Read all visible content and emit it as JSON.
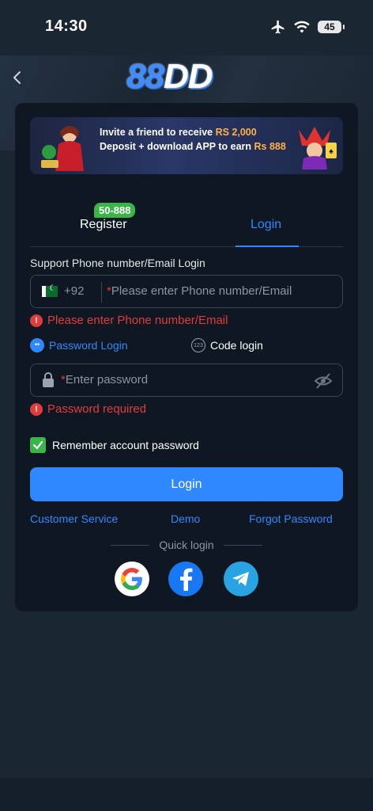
{
  "status": {
    "time": "14:30",
    "battery": "45"
  },
  "header": {
    "logo_a": "88",
    "logo_b": "DD"
  },
  "banner": {
    "line1_text": "Invite a friend to receive",
    "line1_amount": "RS 2,000",
    "line2_text": "Deposit + download APP to earn",
    "line2_amount": "Rs 888"
  },
  "tabs": {
    "register": "Register",
    "login": "Login",
    "register_badge": "50-888"
  },
  "form": {
    "support_label": "Support Phone number/Email Login",
    "country_code": "+92",
    "phone_placeholder": "Please enter Phone number/Email",
    "phone_error": "Please enter Phone number/Email",
    "mode_password": "Password Login",
    "mode_code": "Code login",
    "password_placeholder": "Enter password",
    "password_error": "Password required",
    "remember_label": "Remember account password",
    "login_button": "Login"
  },
  "links": {
    "customer_service": "Customer Service",
    "demo": "Demo",
    "forgot": "Forgot Password"
  },
  "quick_login": {
    "label": "Quick login"
  },
  "colors": {
    "accent": "#2f88ff",
    "error": "#e23b3b",
    "success": "#3bb54a",
    "background": "#1b2633",
    "card": "#0f1822"
  }
}
